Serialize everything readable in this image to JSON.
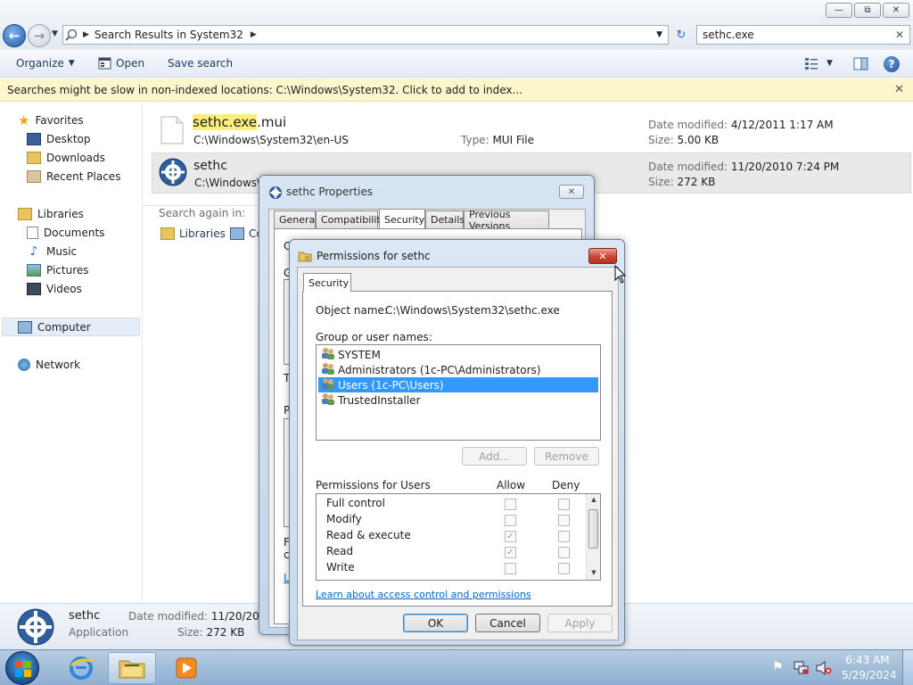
{
  "address": {
    "crumb": "Search Results in System32"
  },
  "search": {
    "value": "sethc.exe"
  },
  "toolbar": {
    "organize": "Organize",
    "open": "Open",
    "save_search": "Save search"
  },
  "infobar": {
    "text": "Searches might be slow in non-indexed locations: C:\\Windows\\System32. Click to add to index..."
  },
  "nav": {
    "favorites": "Favorites",
    "desktop": "Desktop",
    "downloads": "Downloads",
    "recent": "Recent Places",
    "libraries": "Libraries",
    "documents": "Documents",
    "music": "Music",
    "pictures": "Pictures",
    "videos": "Videos",
    "computer": "Computer",
    "network": "Network"
  },
  "results": [
    {
      "name_hl": "sethc.exe",
      "name_rest": ".mui",
      "path": "C:\\Windows\\System32\\en-US",
      "type_label": "Type:",
      "type": "MUI File",
      "date_label": "Date modified:",
      "date": "4/12/2011 1:17 AM",
      "size_label": "Size:",
      "size": "5.00 KB"
    },
    {
      "name": "sethc",
      "path": "C:\\Windows\\System32",
      "date_label": "Date modified:",
      "date": "11/20/2010 7:24 PM",
      "size_label": "Size:",
      "size": "272 KB"
    }
  ],
  "search_again": {
    "label": "Search again in:",
    "libraries": "Libraries",
    "computer_partial": "Co"
  },
  "details": {
    "name": "sethc",
    "type": "Application",
    "date_label": "Date modified:",
    "date": "11/20/2010 7:24 PM",
    "size_label": "Size:",
    "size": "272 KB"
  },
  "props": {
    "title": "sethc Properties",
    "tabs": [
      "General",
      "Compatibility",
      "Security",
      "Details",
      "Previous Versions"
    ],
    "hidden_letters": [
      "O",
      "G",
      "T",
      "P",
      "F",
      "c",
      "L"
    ]
  },
  "perm": {
    "title": "Permissions for sethc",
    "tab": "Security",
    "object_label": "Object name:",
    "object_value": "C:\\Windows\\System32\\sethc.exe",
    "group_label": "Group or user names:",
    "users": [
      "SYSTEM",
      "Administrators (1c-PC\\Administrators)",
      "Users (1c-PC\\Users)",
      "TrustedInstaller"
    ],
    "selected_user": 2,
    "add": "Add...",
    "remove": "Remove",
    "perms_label": "Permissions for Users",
    "allow": "Allow",
    "deny": "Deny",
    "permissions": [
      {
        "name": "Full control",
        "allow": false,
        "deny": false
      },
      {
        "name": "Modify",
        "allow": false,
        "deny": false
      },
      {
        "name": "Read & execute",
        "allow": true,
        "deny": false
      },
      {
        "name": "Read",
        "allow": true,
        "deny": false
      },
      {
        "name": "Write",
        "allow": false,
        "deny": false
      }
    ],
    "link": "Learn about access control and permissions",
    "ok": "OK",
    "cancel": "Cancel",
    "apply": "Apply"
  },
  "clock": {
    "time": "6:43 AM",
    "date": "5/29/2024"
  }
}
